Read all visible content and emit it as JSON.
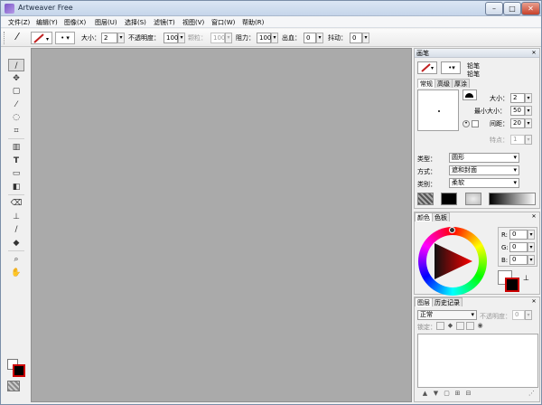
{
  "window": {
    "title": "Artweaver Free"
  },
  "menu": [
    "文件(Z)",
    "编辑(Y)",
    "图像(X)",
    "图层(U)",
    "选择(S)",
    "滤镜(T)",
    "视图(V)",
    "窗口(W)",
    "帮助(R)"
  ],
  "options": {
    "size_label": "大小：",
    "size_value": "2",
    "opacity_label": "不透明度：",
    "opacity_value": "100",
    "grain_label": "颗粒：",
    "grain_value": "100",
    "resist_label": "阻力：",
    "resist_value": "100",
    "bleed_label": "出血：",
    "bleed_value": "0",
    "jitter_label": "抖动：",
    "jitter_value": "0"
  },
  "brush_panel": {
    "title": "画笔",
    "category": "铅笔",
    "variant": "铅笔",
    "tabs": [
      "常规",
      "高级",
      "厚涂"
    ],
    "size_label": "大小：",
    "size_value": "2",
    "min_size_label": "最小大小：",
    "min_size_value": "50",
    "spacing_label": "间距：",
    "spacing_value": "20",
    "feature_label": "特点：",
    "feature_value": "1",
    "type_label": "类型：",
    "type_value": "圆形",
    "method_label": "方式：",
    "method_value": "遮和封面",
    "class_label": "类别：",
    "class_value": "柔软"
  },
  "color_panel": {
    "tabs": [
      "颜色",
      "色板"
    ],
    "r_label": "R:",
    "r_value": "0",
    "g_label": "G:",
    "g_value": "0",
    "b_label": "B:",
    "b_value": "0",
    "foreground": "#000000",
    "background": "#ffffff",
    "accent": "#cc0000"
  },
  "layers_panel": {
    "tabs": [
      "图层",
      "历史记录"
    ],
    "blend_mode": "正常",
    "opacity_label": "不透明度：",
    "opacity_value": "0",
    "lock_label": "锁定："
  }
}
